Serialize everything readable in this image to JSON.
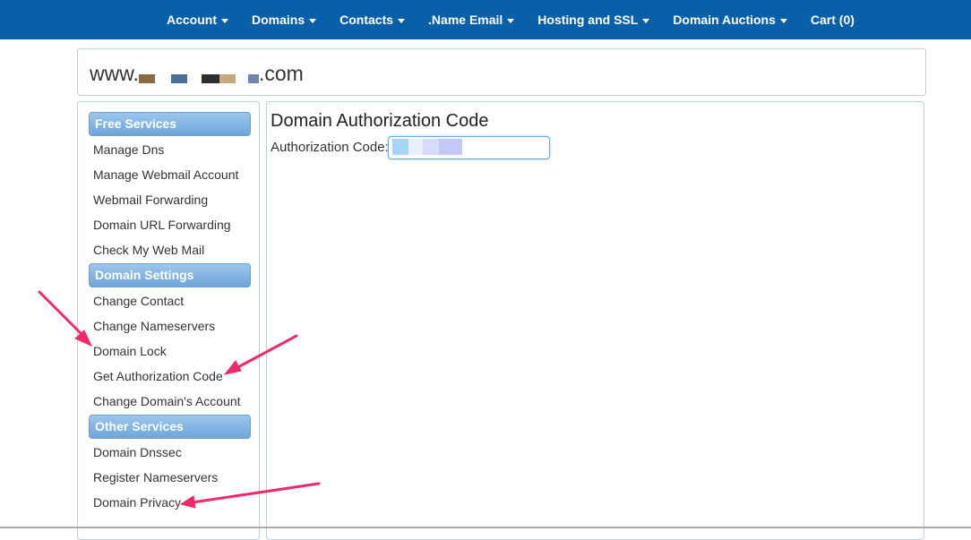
{
  "nav": {
    "items": [
      {
        "label": "Account",
        "has_dropdown": true
      },
      {
        "label": "Domains",
        "has_dropdown": true
      },
      {
        "label": "Contacts",
        "has_dropdown": true
      },
      {
        "label": ".Name Email",
        "has_dropdown": true
      },
      {
        "label": "Hosting and SSL",
        "has_dropdown": true
      },
      {
        "label": "Domain Auctions",
        "has_dropdown": true
      },
      {
        "label": "Cart (0)",
        "has_dropdown": false
      }
    ],
    "background_color": "#0a60a8"
  },
  "domain": {
    "prefix": "www.",
    "suffix": ".com"
  },
  "sidebar": {
    "sections": [
      {
        "title": "Free Services",
        "links": [
          "Manage Dns",
          "Manage Webmail Account",
          "Webmail Forwarding",
          "Domain URL Forwarding",
          "Check My Web Mail"
        ]
      },
      {
        "title": "Domain Settings",
        "links": [
          "Change Contact",
          "Change Nameservers",
          "Domain Lock",
          "Get Authorization Code",
          "Change Domain's Account"
        ]
      },
      {
        "title": "Other Services",
        "links": [
          "Domain Dnssec",
          "Register Nameservers",
          "Domain Privacy"
        ]
      }
    ]
  },
  "main": {
    "title": "Domain Authorization Code",
    "auth_label": "Authorization Code:"
  },
  "annotation_arrow_color": "#ee2a6a"
}
